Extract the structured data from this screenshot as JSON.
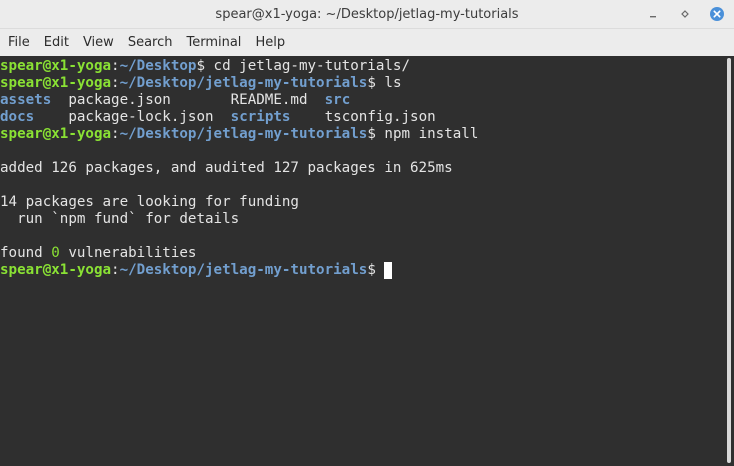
{
  "window": {
    "title": "spear@x1-yoga: ~/Desktop/jetlag-my-tutorials",
    "controls": [
      "minimize-icon",
      "maximize-icon",
      "close-icon"
    ],
    "close_color": "#4a90d9"
  },
  "menu": [
    "File",
    "Edit",
    "View",
    "Search",
    "Terminal",
    "Help"
  ],
  "colors": {
    "background": "#2f2f2f",
    "user_host": "#8ae234",
    "path": "#729fcf",
    "text": "#e4e4e4"
  },
  "terminal": {
    "prompt_user": "spear@x1-yoga",
    "lines": [
      {
        "path": "~/Desktop",
        "cmd": " cd jetlag-my-tutorials/"
      },
      {
        "path": "~/Desktop/jetlag-my-tutorials",
        "cmd": " ls"
      },
      {
        "ls": [
          "assets",
          "package.json",
          "README.md",
          "src"
        ]
      },
      {
        "ls": [
          "docs",
          "package-lock.json",
          "scripts",
          "tsconfig.json"
        ]
      },
      {
        "path": "~/Desktop/jetlag-my-tutorials",
        "cmd": " npm install"
      },
      {
        "text": ""
      },
      {
        "text": "added 126 packages, and audited 127 packages in 625ms"
      },
      {
        "text": ""
      },
      {
        "text": "14 packages are looking for funding"
      },
      {
        "text": "  run `npm fund` for details"
      },
      {
        "text": ""
      },
      {
        "found": [
          "found ",
          "0",
          " vulnerabilities"
        ]
      },
      {
        "path": "~/Desktop/jetlag-my-tutorials",
        "cmd": " "
      }
    ]
  }
}
